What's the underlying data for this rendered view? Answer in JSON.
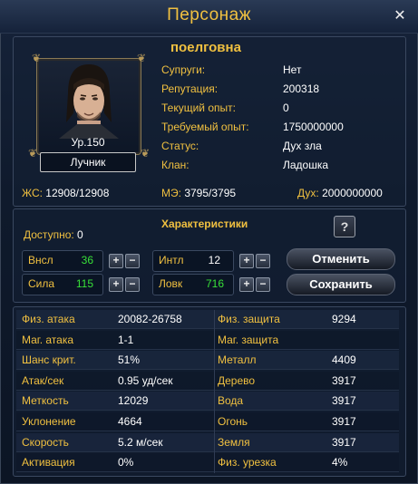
{
  "window": {
    "title": "Персонаж"
  },
  "character": {
    "name": "поелговна",
    "level": "Ур.150",
    "class": "Лучник",
    "info": [
      {
        "label": "Супруги:",
        "value": "Нет"
      },
      {
        "label": "Репутация:",
        "value": "200318"
      },
      {
        "label": "Текущий опыт:",
        "value": "0"
      },
      {
        "label": "Требуемый опыт:",
        "value": "1750000000"
      },
      {
        "label": "Статус:",
        "value": "Дух зла"
      },
      {
        "label": "Клан:",
        "value": "Ладошка"
      }
    ],
    "hp_label": "ЖС:",
    "hp": "12908/12908",
    "mp_label": "МЭ:",
    "mp": "3795/3795",
    "spirit_label": "Дух:",
    "spirit": "2000000000"
  },
  "attributes": {
    "title": "Характеристики",
    "available_label": "Доступно:",
    "available": "0",
    "help": "?",
    "stats": [
      {
        "label": "Внсл",
        "value": "36",
        "color": "#38e038"
      },
      {
        "label": "Интл",
        "value": "12",
        "color": "#ffffff"
      },
      {
        "label": "Сила",
        "value": "115",
        "color": "#38e038"
      },
      {
        "label": "Ловк",
        "value": "716",
        "color": "#38e038"
      }
    ],
    "plus": "+",
    "minus": "−",
    "cancel_label": "Отменить",
    "save_label": "Сохранить"
  },
  "details": [
    {
      "l1": "Физ. атака",
      "v1": "20082-26758",
      "l2": "Физ. защита",
      "v2": "9294"
    },
    {
      "l1": "Маг. атака",
      "v1": "1-1",
      "l2": "Маг. защита",
      "v2": ""
    },
    {
      "l1": "Шанс крит.",
      "v1": "51%",
      "l2": "Металл",
      "v2": "4409"
    },
    {
      "l1": "Атак/сек",
      "v1": "0.95 уд/сек",
      "l2": "Дерево",
      "v2": "3917"
    },
    {
      "l1": "Меткость",
      "v1": "12029",
      "l2": "Вода",
      "v2": "3917"
    },
    {
      "l1": "Уклонение",
      "v1": "4664",
      "l2": "Огонь",
      "v2": "3917"
    },
    {
      "l1": "Скорость",
      "v1": "5.2 м/сек",
      "l2": "Земля",
      "v2": "3917"
    },
    {
      "l1": "Активация",
      "v1": "0%",
      "l2": "Физ. урезка",
      "v2": "4%"
    }
  ]
}
